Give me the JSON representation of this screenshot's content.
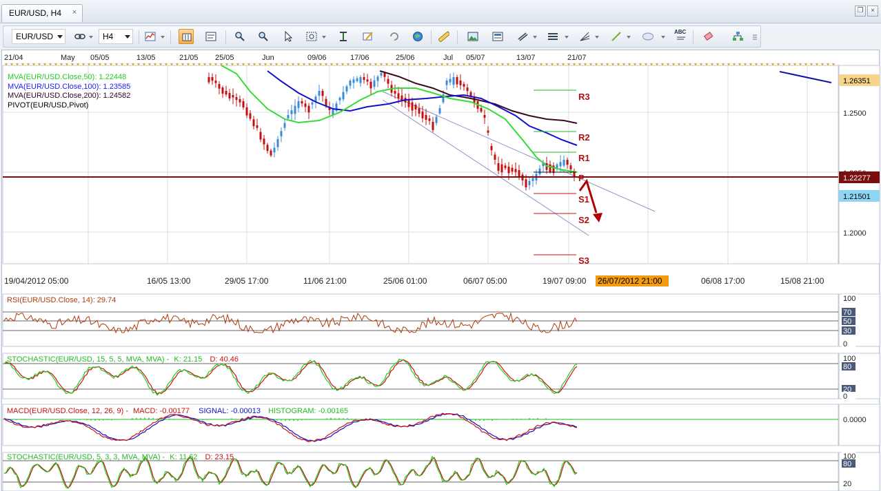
{
  "window": {
    "tab_title": "EUR/USD, H4",
    "tab_close_glyph": "×",
    "restore_glyph": "❐",
    "close_glyph": "×"
  },
  "toolbar": {
    "symbol": "EUR/USD",
    "timeframe": "H4",
    "buttons": [
      {
        "icon": "link-icon"
      },
      {
        "icon": "bar-chart-icon"
      },
      {
        "icon": "candlestick-icon"
      },
      {
        "icon": "line-chart-icon"
      },
      {
        "icon": "zoom-in-icon"
      },
      {
        "icon": "zoom-out-icon"
      },
      {
        "icon": "cursor-icon"
      },
      {
        "icon": "zoom-area-icon"
      },
      {
        "icon": "fit-icon"
      },
      {
        "icon": "pencil-icon"
      },
      {
        "icon": "refresh-icon"
      },
      {
        "icon": "globe-icon"
      },
      {
        "icon": "ruler-icon"
      },
      {
        "icon": "picture-icon"
      },
      {
        "icon": "template-icon"
      },
      {
        "icon": "lines-icon"
      },
      {
        "icon": "horizontal-lines-icon"
      },
      {
        "icon": "fan-icon"
      },
      {
        "icon": "trendline-icon"
      },
      {
        "icon": "ellipse-icon"
      },
      {
        "icon": "text-icon"
      },
      {
        "icon": "eraser-icon"
      },
      {
        "icon": "tree-icon"
      },
      {
        "icon": "more-icon"
      }
    ],
    "text_button_label": "ABC"
  },
  "top_axis": [
    "21/04",
    "May",
    "05/05",
    "13/05",
    "21/05",
    "25/05",
    "Jun",
    "09/06",
    "17/06",
    "25/06",
    "Jul",
    "05/07",
    "13/07",
    "21/07"
  ],
  "bottom_axis": [
    "19/04/2012 05:00",
    "16/05 13:00",
    "29/05 17:00",
    "11/06 21:00",
    "25/06 01:00",
    "06/07 05:00",
    "19/07 09:00",
    "26/07/2012 21:00",
    "06/08 17:00",
    "15/08 21:00"
  ],
  "main_legend": [
    {
      "text": "MVA(EUR/USD.Close,50): 1.22448",
      "color": "#22cc22"
    },
    {
      "text": "MVA(EUR/USD.Close,100): 1.23585",
      "color": "#1a1aff"
    },
    {
      "text": "MVA(EUR/USD.Close,200): 1.24582",
      "color": "#330022"
    },
    {
      "text": "PIVOT(EUR/USD,Pivot)",
      "color": "#000000"
    }
  ],
  "price_axis": {
    "ticks": [
      "1.2500",
      "1.2250",
      "1.2000"
    ],
    "markers": [
      {
        "label": "1.26351",
        "bg": "#f6d48a",
        "color": "#000000"
      },
      {
        "label": "1.22277",
        "bg": "#7a0e0e",
        "color": "#ffffff"
      },
      {
        "label": "1.21501",
        "bg": "#8fd4f2",
        "color": "#000000"
      }
    ]
  },
  "pivots": [
    "R3",
    "R2",
    "R1",
    "P",
    "S1",
    "S2",
    "S3"
  ],
  "rsi": {
    "legend": "RSI(EUR/USD.Close, 14): 29.74",
    "ticks": [
      "100",
      "70",
      "50",
      "30",
      "0"
    ]
  },
  "stoch1": {
    "legend_prefix": "STOCHASTIC(EUR/USD, 15, 5, 5, MVA, MVA) -",
    "k": "K: 21.15",
    "d": "D: 40.46",
    "ticks": [
      "100",
      "80",
      "20",
      "0"
    ]
  },
  "macd": {
    "legend_prefix": "MACD(EUR/USD.Close, 12, 26, 9) -",
    "macd": "MACD: -0.00177",
    "signal": "SIGNAL: -0.00013",
    "hist": "HISTOGRAM: -0.00165",
    "ticks": [
      "0.0000"
    ]
  },
  "stoch2": {
    "legend_prefix": "STOCHASTIC(EUR/USD, 5, 3, 3, MVA, MVA) -",
    "k": "K: 11.62",
    "d": "D: 23.15",
    "ticks": [
      "100",
      "80",
      "20"
    ]
  },
  "colors": {
    "ma50": "#33dd33",
    "ma100": "#1010cc",
    "ma200": "#3a0a1a",
    "pivot": "#7a0e0e",
    "candle": "#c01010",
    "candle_up": "#3a8cd9",
    "rsi": "#b03a0a",
    "stoch_k": "#22cc22",
    "stoch_d": "#cc1111",
    "hist": "#22cc22",
    "signal": "#1010cc",
    "arrow": "#b00000"
  }
}
